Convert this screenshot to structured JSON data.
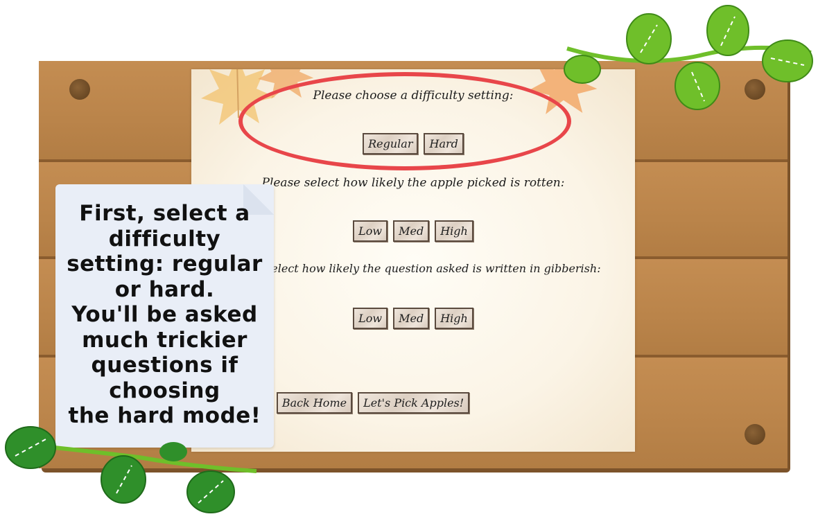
{
  "difficulty": {
    "prompt": "Please choose a difficulty setting:",
    "options": [
      "Regular",
      "Hard"
    ]
  },
  "rotten": {
    "prompt": "Please select how likely the apple picked is rotten:",
    "options": [
      "Low",
      "Med",
      "High"
    ]
  },
  "gibberish": {
    "prompt": "Please select how likely the question asked is written in gibberish:",
    "options": [
      "Low",
      "Med",
      "High"
    ]
  },
  "navigation": {
    "back_label": "Back Home",
    "start_label": "Let's Pick Apples!"
  },
  "tooltip": {
    "lines": [
      "First, select a",
      "difficulty",
      "setting: regular",
      "or hard.",
      "You'll be asked",
      "much trickier",
      "questions if",
      "choosing",
      "the hard mode!"
    ]
  },
  "colors": {
    "board": "#b9854c",
    "panel": "#fbf4e6",
    "highlight": "#e8464a",
    "note": "#e9eef7",
    "vine": "#6fbf2a"
  }
}
